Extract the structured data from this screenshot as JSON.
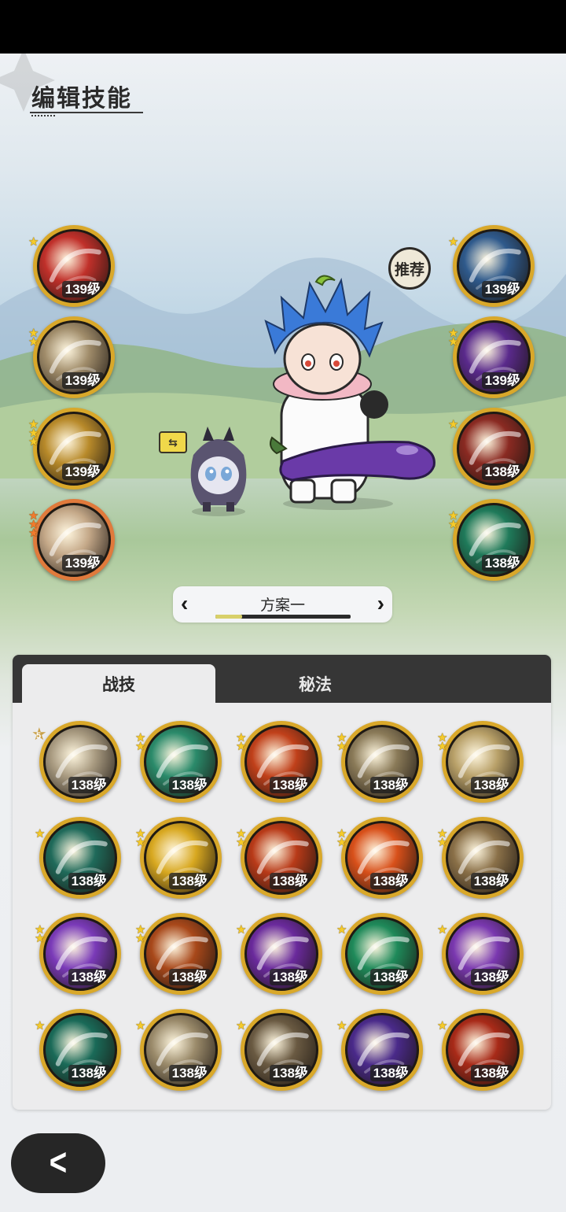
{
  "header": {
    "title": "编辑技能"
  },
  "recommend_label": "推荐",
  "equipped_left": [
    {
      "level": "139级",
      "stars": 1,
      "icon": "sword-strike-icon",
      "color": "#c0302a",
      "border": "gold"
    },
    {
      "level": "139级",
      "stars": 2,
      "icon": "claw-hand-icon",
      "color": "#a08c6a",
      "border": "gold"
    },
    {
      "level": "139级",
      "stars": 3,
      "icon": "wind-slash-icon",
      "color": "#b88a2a",
      "border": "gold"
    },
    {
      "level": "139级",
      "stars": 3,
      "icon": "whirlwind-icon",
      "color": "#c4a888",
      "border": "orange"
    }
  ],
  "equipped_right": [
    {
      "level": "139级",
      "stars": 1,
      "icon": "ice-crest-icon",
      "color": "#2f5a8c",
      "border": "gold"
    },
    {
      "level": "139级",
      "stars": 2,
      "icon": "purple-flame-icon",
      "color": "#5a2a8c",
      "border": "gold"
    },
    {
      "level": "138级",
      "stars": 1,
      "icon": "armor-icon",
      "color": "#8a2a22",
      "border": "gold"
    },
    {
      "level": "138级",
      "stars": 2,
      "icon": "heal-plus-icon",
      "color": "#1f7a5a",
      "border": "gold"
    }
  ],
  "preset": {
    "name": "方案一",
    "progress": 0.2
  },
  "tabs": {
    "active": "战技",
    "other": "秘法"
  },
  "grid": [
    {
      "level": "138级",
      "stars": 5,
      "icon": "tornado-icon",
      "color": "#a89a80"
    },
    {
      "level": "138级",
      "stars": 2,
      "icon": "sword-burst-icon",
      "color": "#2a8a6a"
    },
    {
      "level": "138级",
      "stars": 2,
      "icon": "fire-swirl-icon",
      "color": "#c0401a"
    },
    {
      "level": "138级",
      "stars": 2,
      "icon": "hammer-smash-icon",
      "color": "#8a7a58"
    },
    {
      "level": "138级",
      "stars": 2,
      "icon": "light-slash-icon",
      "color": "#b8a068"
    },
    {
      "level": "138级",
      "stars": 1,
      "icon": "web-icon",
      "color": "#1f6a5a"
    },
    {
      "level": "138级",
      "stars": 2,
      "icon": "golden-gem-icon",
      "color": "#d8a820"
    },
    {
      "level": "138级",
      "stars": 2,
      "icon": "flame-arc-icon",
      "color": "#b83a18"
    },
    {
      "level": "138级",
      "stars": 2,
      "icon": "demon-mark-icon",
      "color": "#d8501a"
    },
    {
      "level": "138级",
      "stars": 2,
      "icon": "explosion-icon",
      "color": "#8a7048"
    },
    {
      "level": "138级",
      "stars": 2,
      "icon": "arcane-orb-icon",
      "color": "#7a3ab8"
    },
    {
      "level": "138级",
      "stars": 2,
      "icon": "fire-ring-icon",
      "color": "#a8481a"
    },
    {
      "level": "138级",
      "stars": 1,
      "icon": "void-heart-icon",
      "color": "#6a2a9c"
    },
    {
      "level": "138级",
      "stars": 1,
      "icon": "green-arrows-icon",
      "color": "#1f8a5a"
    },
    {
      "level": "138级",
      "stars": 1,
      "icon": "purple-roses-icon",
      "color": "#7a38b0"
    },
    {
      "level": "138级",
      "stars": 1,
      "icon": "jade-blade-icon",
      "color": "#1a6a58"
    },
    {
      "level": "138级",
      "stars": 1,
      "icon": "spike-burst-icon",
      "color": "#9a8a6a"
    },
    {
      "level": "138级",
      "stars": 1,
      "icon": "warrior-pose-icon",
      "color": "#6a5a42"
    },
    {
      "level": "138级",
      "stars": 1,
      "icon": "shadow-beast-icon",
      "color": "#4a2a8a"
    },
    {
      "level": "138级",
      "stars": 1,
      "icon": "red-comet-icon",
      "color": "#a82a18"
    }
  ]
}
